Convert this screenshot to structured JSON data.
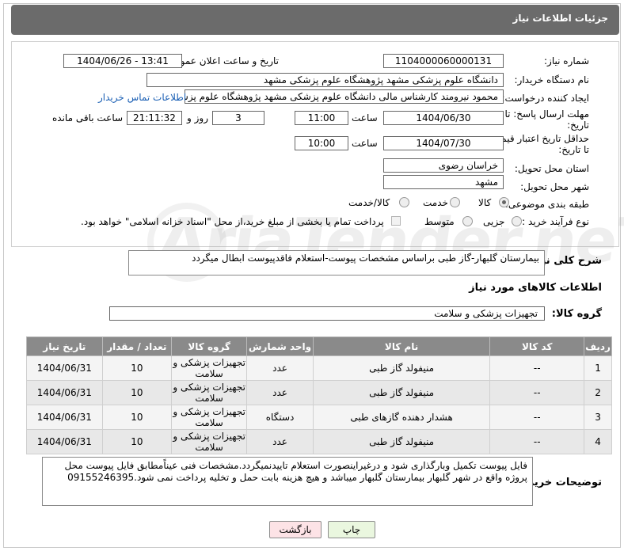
{
  "header": {
    "title": "جزئیات اطلاعات نیاز"
  },
  "fields": {
    "need_number_label": "شماره نیاز:",
    "need_number": "1104000060000131",
    "announce_label": "تاریخ و ساعت اعلان عمومی:",
    "announce_value": "1404/06/26 - 13:41",
    "buyer_org_label": "نام دستگاه خریدار:",
    "buyer_org": "دانشگاه علوم پزشکی مشهد   پژوهشگاه علوم پزشکی مشهد",
    "creator_label": "ایجاد کننده درخواست:",
    "creator": "محمود نیرومند کارشناس مالی دانشگاه علوم پزشکی مشهد   پژوهشگاه علوم پزشکی مشهد",
    "contact_link": "اطلاعات تماس خریدار",
    "deadline_label_1": "مهلت ارسال پاسخ: تا",
    "deadline_label_2": "تاریخ:",
    "deadline_date": "1404/06/30",
    "time_label": "ساعت",
    "deadline_time": "11:00",
    "days_value": "3",
    "days_label": "روز و",
    "remaining_time": "21:11:32",
    "remaining_label": "ساعت باقی مانده",
    "price_label_1": "حداقل تاریخ اعتبار قیمت:",
    "price_label_2": "تا تاریخ:",
    "price_date": "1404/07/30",
    "price_time": "10:00",
    "province_label": "استان محل تحویل:",
    "province": "خراسان رضوی",
    "city_label": "شهر محل تحویل:",
    "city": "مشهد",
    "category_label": "طبقه بندی موضوعی:",
    "category_options": [
      "کالا",
      "خدمت",
      "کالا/خدمت"
    ],
    "process_label": "نوع فرآیند خرید :",
    "process_options": [
      "جزیی",
      "متوسط"
    ],
    "payment_note": "پرداخت تمام یا بخشی از مبلغ خرید،از محل \"اسناد خزانه اسلامی\" خواهد بود."
  },
  "general_desc": {
    "label": "شرح کلی نیاز:",
    "value": "بیمارستان گلبهار-گاز طبی براساس مشخصات پیوست-استعلام فاقدپیوست ابطال میگردد"
  },
  "goods_section_title": "اطلاعات کالاهای مورد نیاز",
  "goods_group": {
    "label": "گروه کالا:",
    "value": "تجهیزات پزشکی و سلامت"
  },
  "table": {
    "headers": [
      "ردیف",
      "کد کالا",
      "نام کالا",
      "واحد شمارش",
      "گروه کالا",
      "تعداد / مقدار",
      "تاریخ نیاز"
    ],
    "rows": [
      [
        "1",
        "--",
        "منیفولد گاز طبی",
        "عدد",
        "تجهیزات پزشکی و سلامت",
        "10",
        "1404/06/31"
      ],
      [
        "2",
        "--",
        "منیفولد گاز طبی",
        "عدد",
        "تجهیزات پزشکی و سلامت",
        "10",
        "1404/06/31"
      ],
      [
        "3",
        "--",
        "هشدار دهنده گازهای طبی",
        "دستگاه",
        "تجهیزات پزشکی و سلامت",
        "10",
        "1404/06/31"
      ],
      [
        "4",
        "--",
        "منیفولد گاز طبی",
        "عدد",
        "تجهیزات پزشکی و سلامت",
        "10",
        "1404/06/31"
      ]
    ]
  },
  "buyer_notes": {
    "label": "توضیحات خریدار:",
    "value": "فایل پیوست تکمیل وبارگذاری شود و درغیراینصورت استعلام تاییدنمیگردد.مشخصات فنی عیناًمطابق فایل پیوست محل پروژه واقع در شهر گلبهار بیمارستان گلبهار میباشد و هیچ هزینه بابت حمل و تخلیه پرداخت نمی شود.09155246395"
  },
  "buttons": {
    "print": "چاپ",
    "back": "بازگشت"
  },
  "watermark": "AriaTender.neT",
  "colors": {
    "header_bg": "#6b6b6b",
    "table_header_bg": "#8a8a8a",
    "back_button_bg": "#fde3e6",
    "print_button_bg": "#eaf7df",
    "link": "#1a5fb4"
  }
}
